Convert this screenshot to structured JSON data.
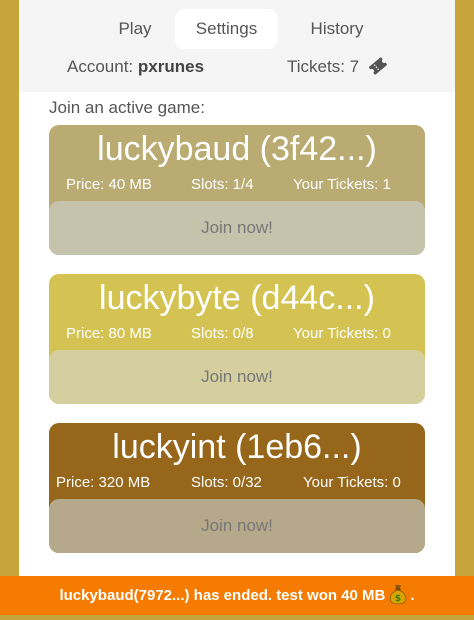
{
  "tabs": [
    {
      "label": "Play",
      "active": false
    },
    {
      "label": "Settings",
      "active": true
    },
    {
      "label": "History",
      "active": false
    }
  ],
  "account": {
    "label": "Account:",
    "name": "pxrunes"
  },
  "tickets": {
    "label": "Tickets:",
    "count": "7",
    "icon": "ticket-icon"
  },
  "join_label": "Join an active game:",
  "games": [
    {
      "title": "luckybaud (3f42...)",
      "price": "Price: 40 MB",
      "slots": "Slots: 1/4",
      "your_tickets": "Your Tickets: 1",
      "button": "Join now!",
      "color": "#b9ab72",
      "button_color": "#c6c3ad"
    },
    {
      "title": "luckybyte (d44c...)",
      "price": "Price: 80 MB",
      "slots": "Slots: 0/8",
      "your_tickets": "Your Tickets: 0",
      "button": "Join now!",
      "color": "#d4c352",
      "button_color": "#d5cf9f"
    },
    {
      "title": "luckyint (1eb6...)",
      "price": "Price: 320 MB",
      "slots": "Slots: 0/32",
      "your_tickets": "Your Tickets: 0",
      "button": "Join now!",
      "color": "#96661b",
      "button_color": "#b6a88a"
    }
  ],
  "toast": {
    "text": "luckybaud(7972...) has ended. test won 40 MB",
    "suffix": ".",
    "icon": "money-bag-icon"
  },
  "colors": {
    "background": "#c7a53a",
    "toast": "#f57c00"
  }
}
